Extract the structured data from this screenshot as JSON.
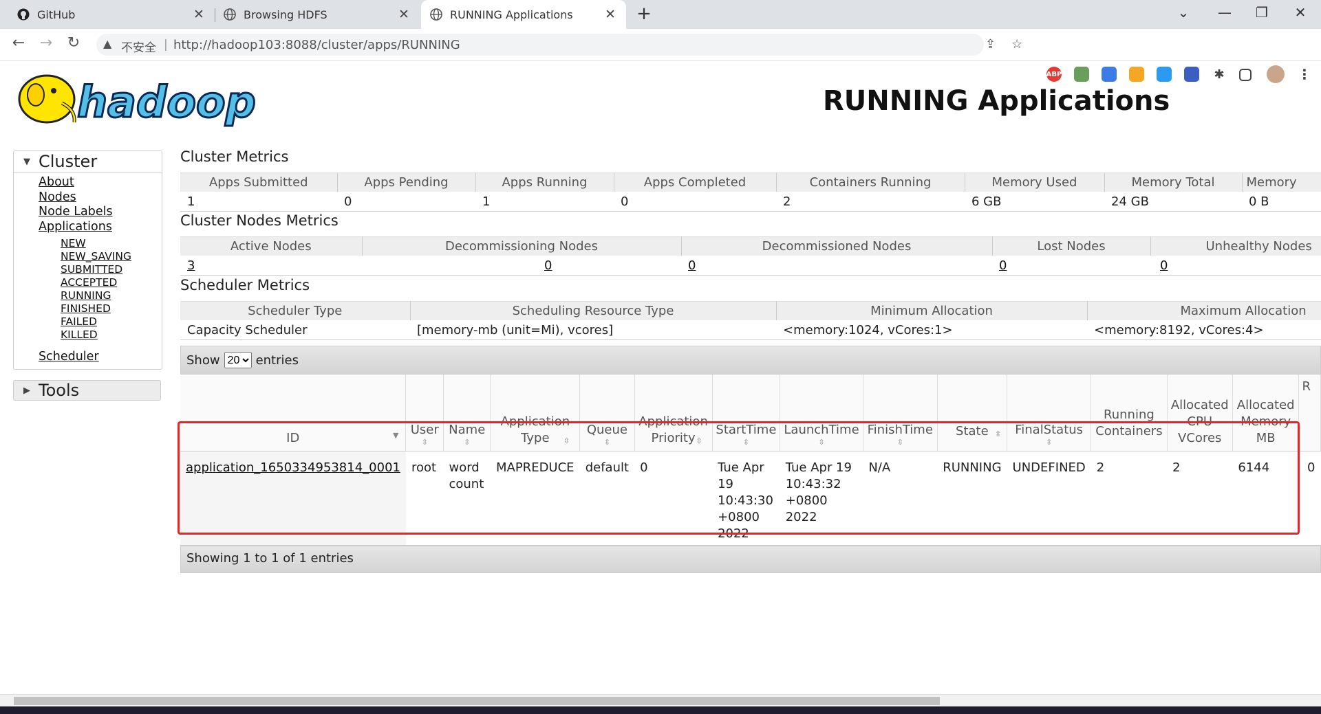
{
  "browser": {
    "tabs": [
      {
        "title": "GitHub",
        "active": false
      },
      {
        "title": "Browsing HDFS",
        "active": false
      },
      {
        "title": "RUNNING Applications",
        "active": true
      }
    ],
    "new_tab": "+",
    "address": {
      "security_label": "不安全",
      "separator": "|",
      "url": "http://hadoop103:8088/cluster/apps/RUNNING"
    },
    "extension_abp": "ABP"
  },
  "logo_text": "hadoop",
  "page_title": "RUNNING Applications",
  "nav": {
    "cluster_label": "Cluster",
    "items": [
      {
        "label": "About"
      },
      {
        "label": "Nodes"
      },
      {
        "label": "Node Labels"
      },
      {
        "label": "Applications"
      }
    ],
    "app_states": [
      "NEW",
      "NEW_SAVING",
      "SUBMITTED",
      "ACCEPTED",
      "RUNNING",
      "FINISHED",
      "FAILED",
      "KILLED"
    ],
    "scheduler_label": "Scheduler",
    "tools_label": "Tools"
  },
  "cluster_metrics": {
    "title": "Cluster Metrics",
    "headers": [
      "Apps Submitted",
      "Apps Pending",
      "Apps Running",
      "Apps Completed",
      "Containers Running",
      "Memory Used",
      "Memory Total",
      "Memory"
    ],
    "values": [
      "1",
      "0",
      "1",
      "0",
      "2",
      "6 GB",
      "24 GB",
      "0 B"
    ]
  },
  "nodes_metrics": {
    "title": "Cluster Nodes Metrics",
    "headers": [
      "Active Nodes",
      "Decommissioning Nodes",
      "Decommissioned Nodes",
      "Lost Nodes",
      "Unhealthy Nodes"
    ],
    "values": [
      "3",
      "0",
      "0",
      "0",
      "0"
    ]
  },
  "scheduler_metrics": {
    "title": "Scheduler Metrics",
    "headers": [
      "Scheduler Type",
      "Scheduling Resource Type",
      "Minimum Allocation",
      "Maximum Allocation"
    ],
    "values": [
      "Capacity Scheduler",
      "[memory-mb (unit=Mi), vcores]",
      "<memory:1024, vCores:1>",
      "<memory:8192, vCores:4>"
    ]
  },
  "apps_table": {
    "show_label": "Show",
    "page_size": "20",
    "entries_label": "entries",
    "columns": [
      "ID",
      "User",
      "Name",
      "Application Type",
      "Queue",
      "Application Priority",
      "StartTime",
      "LaunchTime",
      "FinishTime",
      "State",
      "FinalStatus",
      "Running Containers",
      "Allocated CPU VCores",
      "Allocated Memory MB",
      "R"
    ],
    "rows": [
      {
        "id": "application_1650334953814_0001",
        "user": "root",
        "name": "word count",
        "type": "MAPREDUCE",
        "queue": "default",
        "priority": "0",
        "start_time": "Tue Apr 19 10:43:30 +0800 2022",
        "launch_time": "Tue Apr 19 10:43:32 +0800 2022",
        "finish_time": "N/A",
        "state": "RUNNING",
        "final_status": "UNDEFINED",
        "running_containers": "2",
        "allocated_vcores": "2",
        "allocated_memory": "6144",
        "truncated": "0"
      }
    ],
    "footer": "Showing 1 to 1 of 1 entries"
  }
}
